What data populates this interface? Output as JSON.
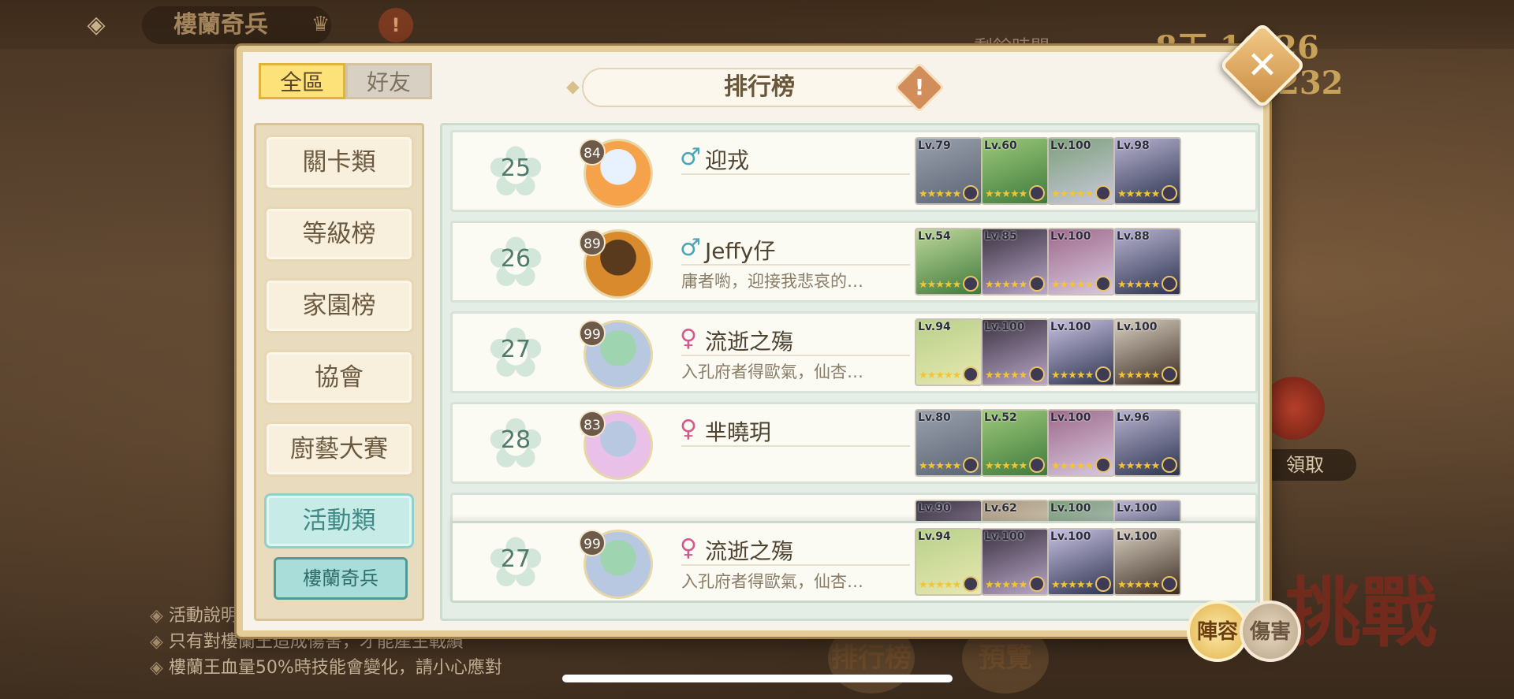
{
  "background": {
    "event_title": "樓蘭奇兵",
    "timer_label": "剩餘時間",
    "timer_value": "8天 10:26",
    "score_value": "232",
    "claim_label": "領取",
    "challenge_label": "挑戰",
    "notes": [
      "活動說明",
      "只有對樓蘭王造成傷害，才能產生戰績",
      "樓蘭王血量50%時技能會變化，請小心應對"
    ],
    "ranking_btn": "排行榜",
    "preview_btn": "預覽"
  },
  "dialog": {
    "title": "排行榜",
    "tabs": [
      {
        "label": "全區",
        "active": true
      },
      {
        "label": "好友",
        "active": false
      }
    ],
    "categories": [
      {
        "label": "關卡類",
        "active": false
      },
      {
        "label": "等級榜",
        "active": false
      },
      {
        "label": "家園榜",
        "active": false
      },
      {
        "label": "協會",
        "active": false
      },
      {
        "label": "廚藝大賽",
        "active": false
      },
      {
        "label": "活動類",
        "active": true
      }
    ],
    "subcategory": "樓蘭奇兵",
    "rows": [
      {
        "rank": "25",
        "level": "84",
        "gender": "♂",
        "gender_type": "male",
        "name": "迎戎",
        "motto": "",
        "avatar_colors": [
          "#f6a24a",
          "#e8f2ff"
        ],
        "cards": [
          {
            "lv": "Lv.79",
            "colors": [
              "#5b6474",
              "#9aa1ad"
            ]
          },
          {
            "lv": "Lv.60",
            "colors": [
              "#3f7a3c",
              "#9cc87a"
            ]
          },
          {
            "lv": "Lv.100",
            "colors": [
              "#c9c8dc",
              "#7ea07a"
            ]
          },
          {
            "lv": "Lv.98",
            "colors": [
              "#2c3350",
              "#b8b3d0"
            ]
          }
        ]
      },
      {
        "rank": "26",
        "level": "89",
        "gender": "♂",
        "gender_type": "male",
        "name": "Jeffy仔",
        "motto": "庸者喲，迎接我悲哀的…",
        "avatar_colors": [
          "#d88a2c",
          "#5a3a1c"
        ],
        "cards": [
          {
            "lv": "Lv.54",
            "colors": [
              "#3f7a3c",
              "#bfd89a"
            ]
          },
          {
            "lv": "Lv.85",
            "colors": [
              "#b9a6c8",
              "#3a3340"
            ]
          },
          {
            "lv": "Lv.100",
            "colors": [
              "#d8c8e0",
              "#9e6a8a"
            ]
          },
          {
            "lv": "Lv.88",
            "colors": [
              "#2c3350",
              "#b8b3d0"
            ]
          }
        ]
      },
      {
        "rank": "27",
        "level": "99",
        "gender": "♀",
        "gender_type": "female",
        "name": "流逝之殤",
        "motto": "入孔府者得歐氣，仙杏…",
        "avatar_colors": [
          "#b8c8e0",
          "#9ed4b0"
        ],
        "cards": [
          {
            "lv": "Lv.94",
            "colors": [
              "#e8e8b0",
              "#b8d08a"
            ]
          },
          {
            "lv": "Lv.100",
            "colors": [
              "#b9a6c8",
              "#3a3340"
            ]
          },
          {
            "lv": "Lv.100",
            "colors": [
              "#2c3350",
              "#c8c0e0"
            ]
          },
          {
            "lv": "Lv.100",
            "colors": [
              "#3a2a22",
              "#d8d0c0"
            ]
          }
        ]
      },
      {
        "rank": "28",
        "level": "83",
        "gender": "♀",
        "gender_type": "female",
        "name": "芈曉玥",
        "motto": "",
        "avatar_colors": [
          "#e8c0e8",
          "#b8c8e0"
        ],
        "cards": [
          {
            "lv": "Lv.80",
            "colors": [
              "#5b6474",
              "#9aa1ad"
            ]
          },
          {
            "lv": "Lv.52",
            "colors": [
              "#3f7a3c",
              "#9cc87a"
            ]
          },
          {
            "lv": "Lv.100",
            "colors": [
              "#d8c8e0",
              "#9e6a8a"
            ]
          },
          {
            "lv": "Lv.96",
            "colors": [
              "#2c3350",
              "#b8b3d0"
            ]
          }
        ]
      }
    ],
    "partial_row": {
      "cards": [
        {
          "lv": "Lv.90",
          "colors": [
            "#b9a6c8",
            "#3a3340"
          ]
        },
        {
          "lv": "Lv.62",
          "colors": [
            "#e8e0d0",
            "#a89880"
          ]
        },
        {
          "lv": "Lv.100",
          "colors": [
            "#c9c8dc",
            "#7ea07a"
          ]
        },
        {
          "lv": "Lv.100",
          "colors": [
            "#2c3350",
            "#b8b3d0"
          ]
        }
      ]
    },
    "my_row": {
      "rank": "27",
      "level": "99",
      "gender": "♀",
      "gender_type": "female",
      "name": "流逝之殤",
      "motto": "入孔府者得歐氣，仙杏…",
      "avatar_colors": [
        "#b8c8e0",
        "#9ed4b0"
      ],
      "cards": [
        {
          "lv": "Lv.94",
          "colors": [
            "#e8e8b0",
            "#b8d08a"
          ]
        },
        {
          "lv": "Lv.100",
          "colors": [
            "#b9a6c8",
            "#3a3340"
          ]
        },
        {
          "lv": "Lv.100",
          "colors": [
            "#2c3350",
            "#c8c0e0"
          ]
        },
        {
          "lv": "Lv.100",
          "colors": [
            "#3a2a22",
            "#d8d0c0"
          ]
        }
      ]
    },
    "lineup_btn": "陣容",
    "damage_btn": "傷害"
  }
}
